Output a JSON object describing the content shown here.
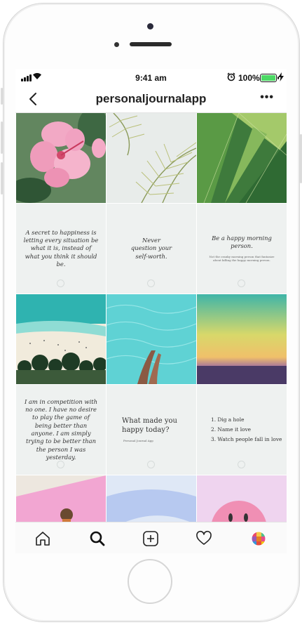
{
  "status": {
    "time": "9:41 am",
    "battery": "100%"
  },
  "header": {
    "username": "personaljournalapp",
    "more": "•••"
  },
  "posts": [
    {
      "kind": "photo",
      "subject": "pink hibiscus flower"
    },
    {
      "kind": "photo",
      "subject": "palm fronds"
    },
    {
      "kind": "photo",
      "subject": "banana leaves"
    },
    {
      "kind": "quote",
      "text": "A secret to happiness is letting every situation be what it is, instead of what you think it should be."
    },
    {
      "kind": "quote",
      "text": "Never question your self-worth."
    },
    {
      "kind": "quote",
      "text": "Be a happy morning person.",
      "subtext": "Not the cranky morning person that fantasize about killing the happy morning person."
    },
    {
      "kind": "photo",
      "subject": "aerial beach"
    },
    {
      "kind": "photo",
      "subject": "feet in turquoise water"
    },
    {
      "kind": "photo",
      "subject": "sunset over sea"
    },
    {
      "kind": "quote",
      "text": "I am in competition with no one. I have no desire to play the game of being better than anyone. I am simply trying to be better than the person I was yesterday."
    },
    {
      "kind": "quote",
      "text": "What made you happy today?",
      "subtext": "Personal Journal App"
    },
    {
      "kind": "quote",
      "list": [
        "1. Dig a hole",
        "2. Name it love",
        "3. Watch people fall in love"
      ]
    },
    {
      "kind": "photo",
      "subject": "pink wall"
    },
    {
      "kind": "photo",
      "subject": "blue sky"
    },
    {
      "kind": "photo",
      "subject": "smiley balloon"
    }
  ],
  "tabs": [
    "home-icon",
    "search-icon",
    "add-post-icon",
    "heart-icon",
    "profile-avatar"
  ],
  "colors": {
    "battery": "#4cd964",
    "quote_bg": "#eef1f0"
  }
}
